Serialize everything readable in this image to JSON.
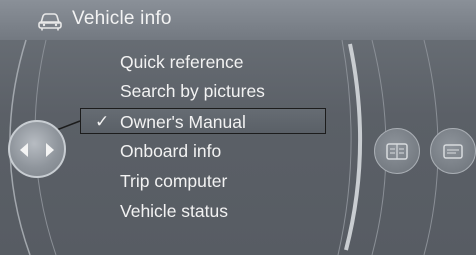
{
  "header": {
    "title": "Vehicle info",
    "icon": "car-icon"
  },
  "menu": {
    "items": [
      {
        "label": "Quick reference",
        "selected": false
      },
      {
        "label": "Search by pictures",
        "selected": false
      },
      {
        "label": "Owner's Manual",
        "selected": true
      },
      {
        "label": "Onboard info",
        "selected": false
      },
      {
        "label": "Trip computer",
        "selected": false
      },
      {
        "label": "Vehicle status",
        "selected": false
      }
    ],
    "selected_marker": "✓"
  },
  "controls": {
    "controller_icon": "left-right-arrows-icon",
    "side_buttons": [
      "car-book-icon",
      "manual-icon"
    ]
  },
  "colors": {
    "background": "#5b6067",
    "titlebar": "#7e848c",
    "text": "#f2f2f2",
    "selection_border": "#1c1c1c"
  }
}
